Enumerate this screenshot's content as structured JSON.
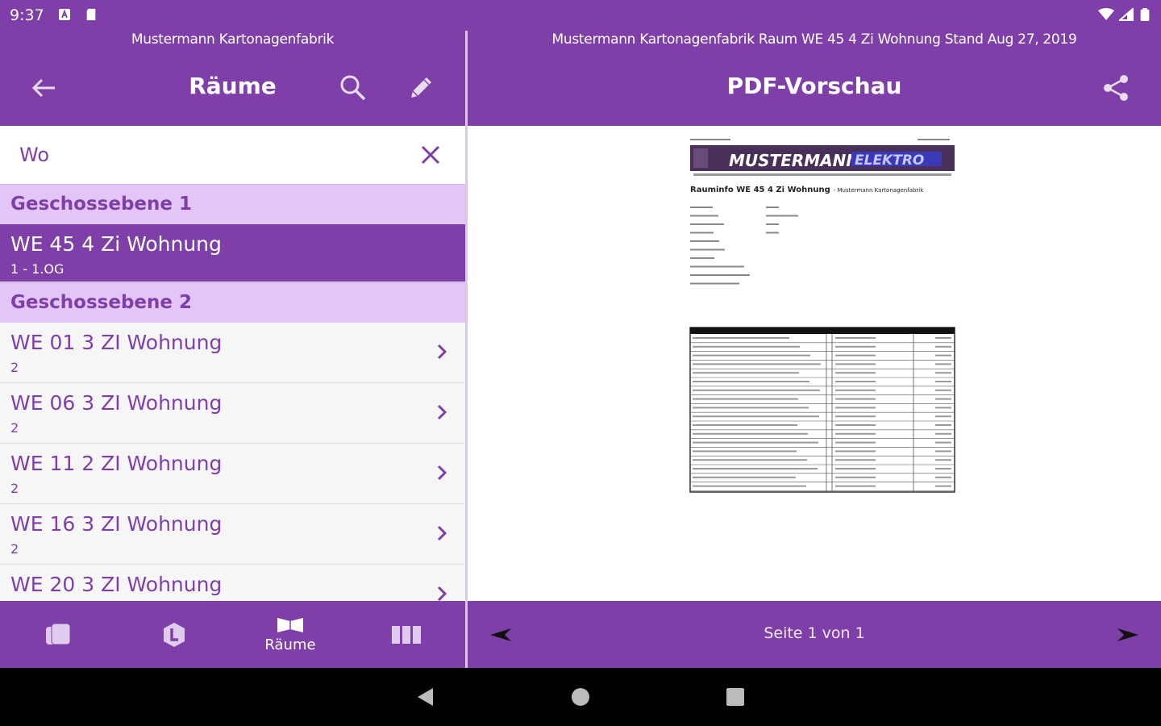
{
  "status_bar": {
    "time": "9:37"
  },
  "left": {
    "subtitle": "Mustermann Kartonagenfabrik",
    "title": "Räume",
    "search": {
      "value": "Wo"
    },
    "sections": [
      {
        "header": "Geschossebene 1",
        "items": [
          {
            "title": "WE 45 4 Zi Wohnung",
            "sub": "1 - 1.OG",
            "selected": true
          }
        ]
      },
      {
        "header": "Geschossebene 2",
        "items": [
          {
            "title": "WE 01 3 ZI Wohnung",
            "sub": "2"
          },
          {
            "title": "WE 06 3 ZI Wohnung",
            "sub": "2"
          },
          {
            "title": "WE 11 2 ZI Wohnung",
            "sub": "2"
          },
          {
            "title": "WE 16 3 ZI Wohnung",
            "sub": "2"
          },
          {
            "title": "WE 20 3 ZI Wohnung",
            "sub": ""
          }
        ]
      }
    ],
    "tabs": [
      {
        "label": ""
      },
      {
        "label": ""
      },
      {
        "label": "Räume"
      },
      {
        "label": ""
      }
    ]
  },
  "right": {
    "subtitle": "Mustermann Kartonagenfabrik Raum WE 45 4 Zi Wohnung Stand Aug 27, 2019",
    "title": "PDF-Vorschau",
    "page_indicator": "Seite 1 von 1",
    "pdf": {
      "logo_text_1": "MUSTERMANN",
      "logo_text_2": "ELEKTRO",
      "heading": "Rauminfo WE 45 4 Zi Wohnung",
      "heading_sub": "- Mustermann Kartonagenfabrik"
    }
  },
  "colors": {
    "primary": "#7f3fa8",
    "section": "#e3c6f7"
  }
}
